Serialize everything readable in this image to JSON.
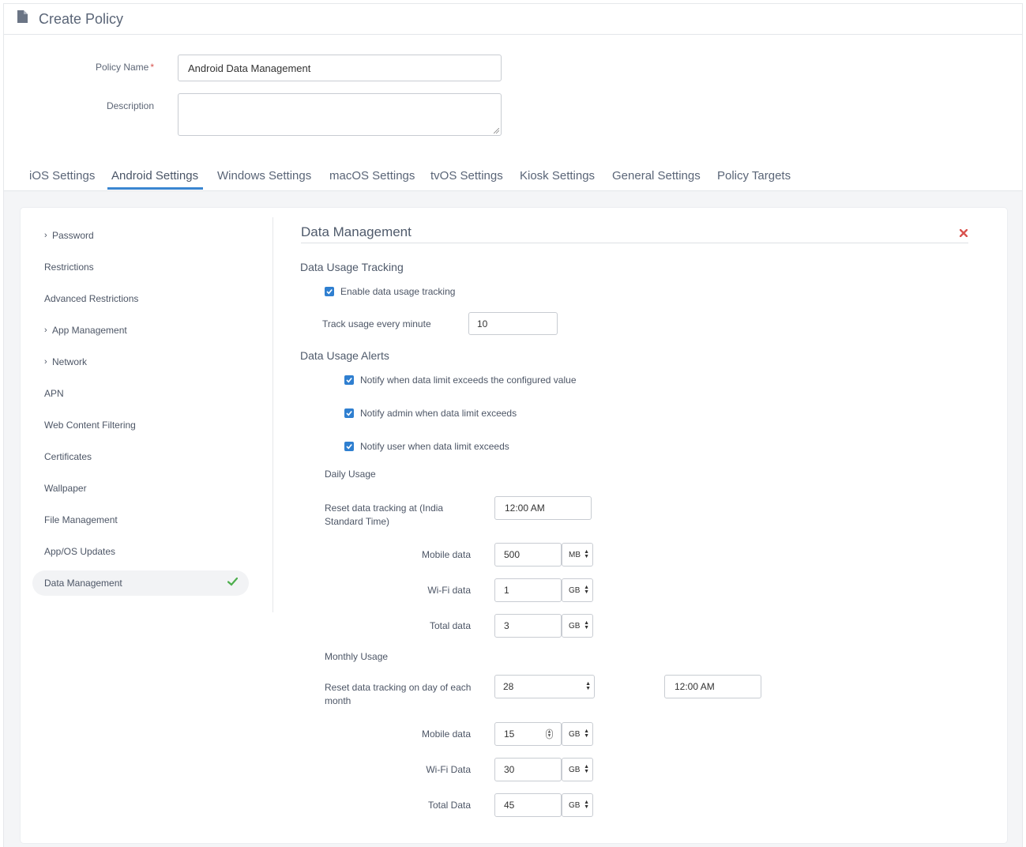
{
  "header": {
    "title": "Create Policy",
    "icon": "document-icon"
  },
  "form": {
    "policy_name_label": "Policy Name",
    "required_mark": "*",
    "policy_name_value": "Android Data Management",
    "description_label": "Description",
    "description_value": ""
  },
  "tabs": [
    {
      "label": "iOS Settings"
    },
    {
      "label": "Android Settings"
    },
    {
      "label": "Windows Settings"
    },
    {
      "label": "macOS Settings"
    },
    {
      "label": "tvOS Settings"
    },
    {
      "label": "Kiosk Settings"
    },
    {
      "label": "General Settings"
    },
    {
      "label": "Policy Targets"
    }
  ],
  "active_tab": "Android Settings",
  "sidebar": {
    "items": [
      {
        "label": "Password",
        "expandable": true
      },
      {
        "label": "Restrictions",
        "expandable": false
      },
      {
        "label": "Advanced Restrictions",
        "expandable": false
      },
      {
        "label": "App Management",
        "expandable": true
      },
      {
        "label": "Network",
        "expandable": true
      },
      {
        "label": "APN",
        "expandable": false
      },
      {
        "label": "Web Content Filtering",
        "expandable": false
      },
      {
        "label": "Certificates",
        "expandable": false
      },
      {
        "label": "Wallpaper",
        "expandable": false
      },
      {
        "label": "File Management",
        "expandable": false
      },
      {
        "label": "App/OS Updates",
        "expandable": false
      },
      {
        "label": "Data Management",
        "expandable": false,
        "active": true
      }
    ],
    "chevron": "›"
  },
  "panel": {
    "title": "Data Management",
    "tracking": {
      "title": "Data Usage Tracking",
      "enable_label": "Enable data usage tracking",
      "enable_checked": true,
      "interval_label": "Track usage every minute",
      "interval_value": "10"
    },
    "alerts": {
      "title": "Data Usage Alerts",
      "checkboxes": [
        {
          "label": "Notify when data limit exceeds the configured value",
          "checked": true
        },
        {
          "label": "Notify admin when data limit exceeds",
          "checked": true
        },
        {
          "label": "Notify user when data limit exceeds",
          "checked": true
        }
      ]
    },
    "daily": {
      "title": "Daily Usage",
      "reset_label": "Reset data tracking at (India Standard Time)",
      "reset_time": "12:00 AM",
      "mobile_label": "Mobile data",
      "mobile_value": "500",
      "mobile_unit": "MB",
      "wifi_label": "Wi-Fi data",
      "wifi_value": "1",
      "wifi_unit": "GB",
      "total_label": "Total data",
      "total_value": "3",
      "total_unit": "GB"
    },
    "monthly": {
      "title": "Monthly Usage",
      "reset_label": "Reset data tracking on day of each month",
      "reset_day": "28",
      "reset_time": "12:00 AM",
      "mobile_label": "Mobile data",
      "mobile_value": "15",
      "mobile_unit": "GB",
      "wifi_label": "Wi-Fi Data",
      "wifi_value": "30",
      "wifi_unit": "GB",
      "total_label": "Total Data",
      "total_value": "45",
      "total_unit": "GB"
    }
  },
  "colors": {
    "accent": "#3a86d1",
    "checkbox": "#2f7fd0",
    "success": "#4cae4c",
    "danger": "#d9534f"
  }
}
